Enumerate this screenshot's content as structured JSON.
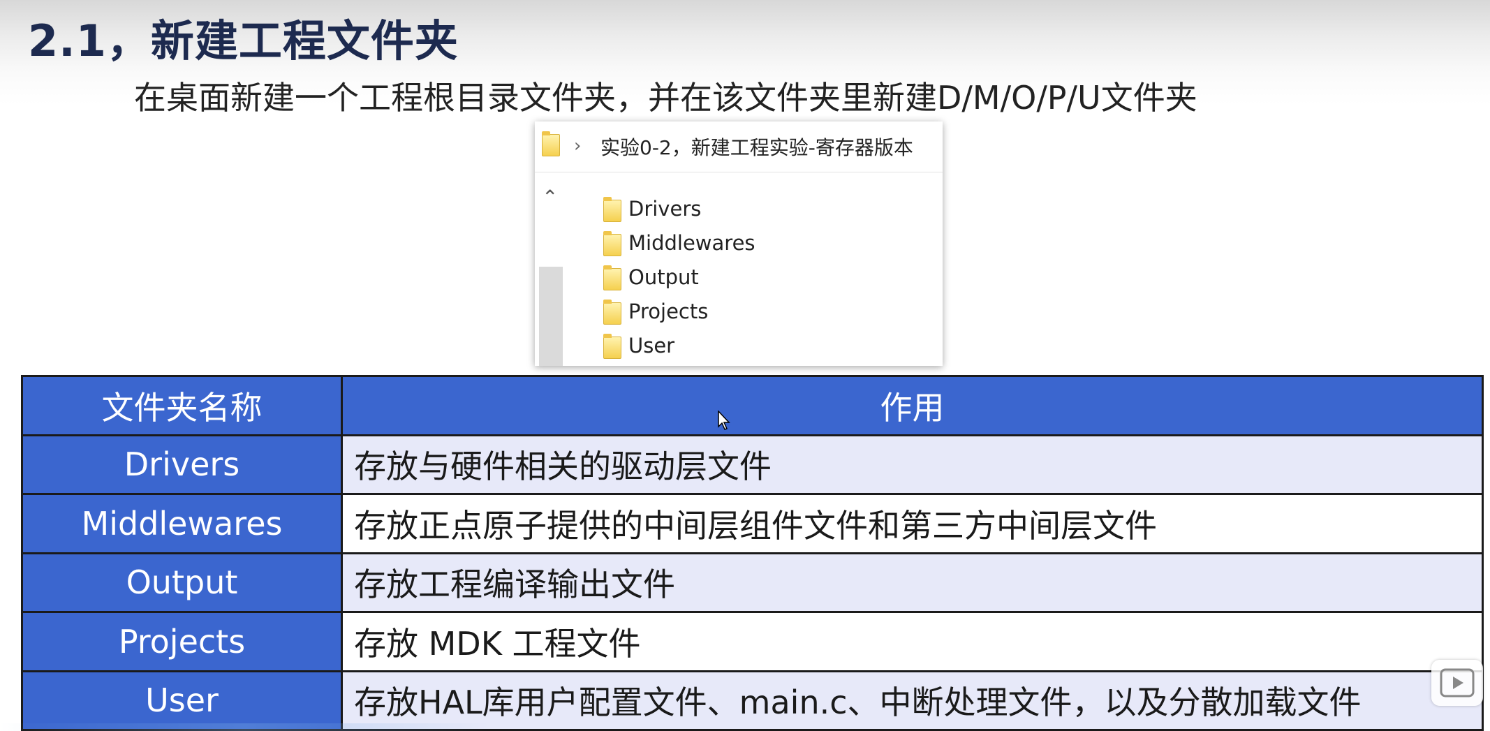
{
  "slide": {
    "title": "2.1，新建工程文件夹",
    "subtitle": "在桌面新建一个工程根目录文件夹，并在该文件夹里新建D/M/O/P/U文件夹"
  },
  "explorer": {
    "address_path": "实验0-2，新建工程实验-寄存器版本",
    "items": [
      {
        "label": "Drivers"
      },
      {
        "label": "Middlewares"
      },
      {
        "label": "Output"
      },
      {
        "label": "Projects"
      },
      {
        "label": "User"
      }
    ]
  },
  "table": {
    "headers": [
      "文件夹名称",
      "作用"
    ],
    "rows": [
      {
        "name": "Drivers",
        "purpose": "存放与硬件相关的驱动层文件"
      },
      {
        "name": "Middlewares",
        "purpose": "存放正点原子提供的中间层组件文件和第三方中间层文件"
      },
      {
        "name": "Output",
        "purpose": "存放工程编译输出文件"
      },
      {
        "name": "Projects",
        "purpose": "存放 MDK 工程文件"
      },
      {
        "name": "User",
        "purpose": "存放HAL库用户配置文件、main.c、中断处理文件，以及分散加载文件"
      }
    ]
  },
  "colors": {
    "header_blue": "#3b66cf",
    "row_tint": "#e7e9f9",
    "title_color": "#1d2a4f"
  },
  "icons": [
    "folder-icon",
    "chevron-right-icon",
    "chevron-up-icon",
    "mouse-cursor-icon",
    "play-icon"
  ]
}
